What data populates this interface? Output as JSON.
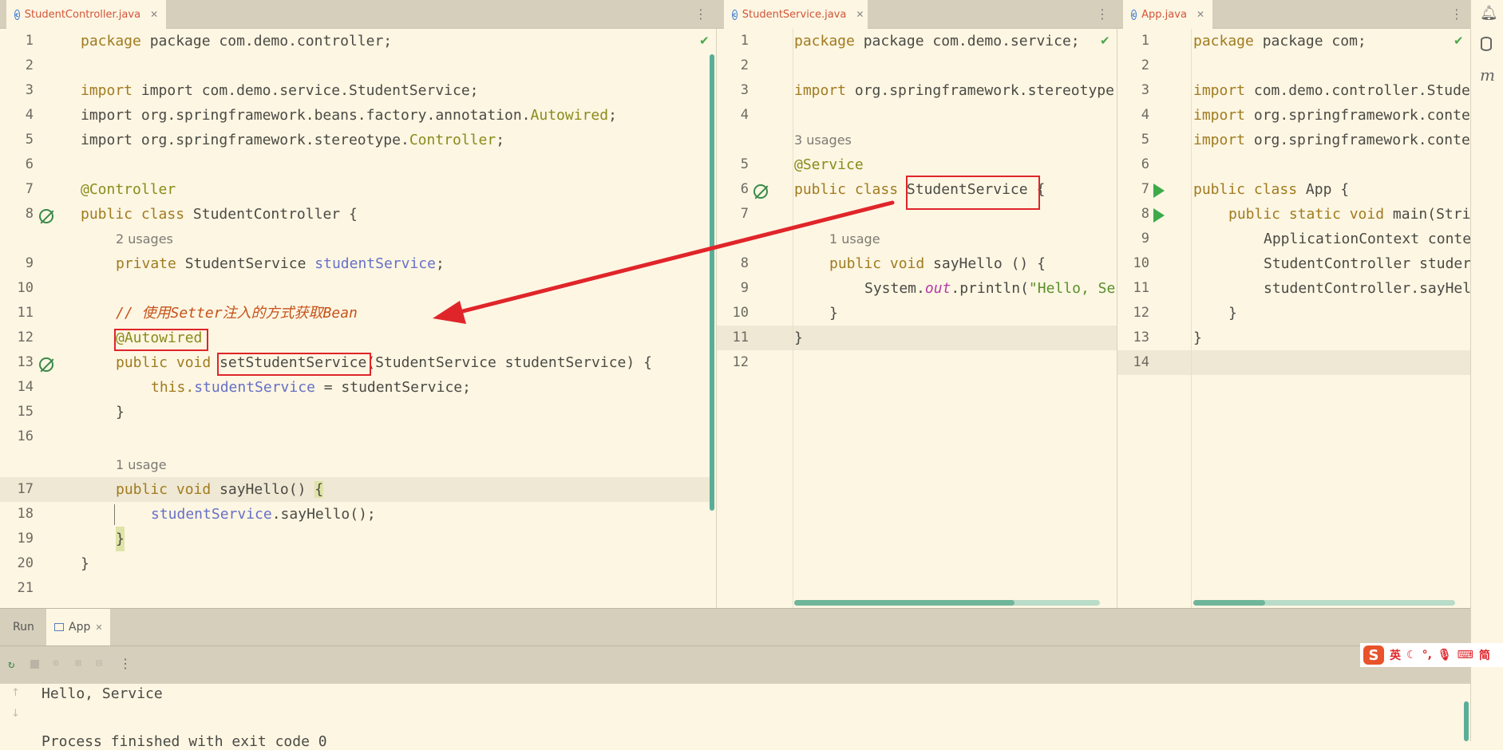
{
  "tabs": {
    "pane1": {
      "name": "StudentController.java"
    },
    "pane2": {
      "name": "StudentService.java"
    },
    "pane3": {
      "name": "App.java"
    }
  },
  "pane1": {
    "lines": [
      {
        "n": "1"
      },
      {
        "n": "2"
      },
      {
        "n": "3"
      },
      {
        "n": "4"
      },
      {
        "n": "5"
      },
      {
        "n": "6"
      },
      {
        "n": "7"
      },
      {
        "n": "8"
      },
      {
        "n": "9"
      },
      {
        "n": "10"
      },
      {
        "n": "11"
      },
      {
        "n": "12"
      },
      {
        "n": "13"
      },
      {
        "n": "14"
      },
      {
        "n": "15"
      },
      {
        "n": "16"
      },
      {
        "n": "17"
      },
      {
        "n": "18"
      },
      {
        "n": "19"
      },
      {
        "n": "20"
      },
      {
        "n": "21"
      }
    ],
    "usages": {
      "field": "2 usages",
      "method": "1 usage"
    },
    "code": {
      "l1": "package com.demo.controller;",
      "l3": "import com.demo.service.StudentService;",
      "l4a": "import org.springframework.beans.factory.annotation.",
      "l4b": "Autowired",
      "l4c": ";",
      "l5a": "import org.springframework.stereotype.",
      "l5b": "Controller",
      "l5c": ";",
      "l7": "@Controller",
      "l8a": "public class ",
      "l8b": "StudentController {",
      "l9a": "private ",
      "l9b": "StudentService ",
      "l9c": "studentService",
      "l9d": ";",
      "l11": "// 使用Setter注入的方式获取Bean",
      "l12": "@Autowired",
      "l13a": "public void ",
      "l13b": "setStudentService",
      "l13c": "(StudentService studentService) {",
      "l14a": "this.",
      "l14b": "studentService",
      "l14c": " = studentService;",
      "l15": "}",
      "l17a": "public void ",
      "l17b": "sayHello() ",
      "l17c": "{",
      "l18a": "studentService",
      "l18b": ".sayHello();",
      "l19": "}",
      "l20": "}"
    }
  },
  "pane2": {
    "lines": [
      {
        "n": "1"
      },
      {
        "n": "2"
      },
      {
        "n": "3"
      },
      {
        "n": "4"
      },
      {
        "n": "5"
      },
      {
        "n": "6"
      },
      {
        "n": "7"
      },
      {
        "n": "8"
      },
      {
        "n": "9"
      },
      {
        "n": "10"
      },
      {
        "n": "11"
      },
      {
        "n": "12"
      }
    ],
    "usages": {
      "class": "3 usages",
      "method": "1 usage"
    },
    "code": {
      "l1": "package com.demo.service;",
      "l3a": "import ",
      "l3b": "org.springframework.stereotype",
      "l5": "@Service",
      "l6a": "public class ",
      "l6b": "StudentService",
      "l6c": " {",
      "l8a": "public void ",
      "l8b": "sayHello () {",
      "l9a": "System.",
      "l9b": "out",
      "l9c": ".println(",
      "l9d": "\"Hello, Se",
      "l10": "}",
      "l11": "}"
    }
  },
  "pane3": {
    "lines": [
      {
        "n": "1"
      },
      {
        "n": "2"
      },
      {
        "n": "3"
      },
      {
        "n": "4"
      },
      {
        "n": "5"
      },
      {
        "n": "6"
      },
      {
        "n": "7"
      },
      {
        "n": "8"
      },
      {
        "n": "9"
      },
      {
        "n": "10"
      },
      {
        "n": "11"
      },
      {
        "n": "12"
      },
      {
        "n": "13"
      },
      {
        "n": "14"
      }
    ],
    "code": {
      "l1": "package com;",
      "l3a": "import ",
      "l3b": "com.demo.controller.Stude",
      "l4a": "import ",
      "l4b": "org.springframework.conte",
      "l5a": "import ",
      "l5b": "org.springframework.conte",
      "l7a": "public class ",
      "l7b": "App {",
      "l8a": "public static void ",
      "l8b": "main(Stri",
      "l9": "ApplicationContext conte",
      "l10": "StudentController studer",
      "l11": "studentController.sayHel",
      "l12": "}",
      "l13": "}"
    }
  },
  "bottom": {
    "run_label": "Run",
    "app_tab": "App",
    "console_line1": "Hello, Service",
    "console_line2": "Process finished with exit code 0"
  },
  "ime": {
    "mode": "英",
    "simplified": "简"
  },
  "colors": {
    "highlight_red": "#e0252a",
    "editor_bg": "#fdf6e3"
  }
}
